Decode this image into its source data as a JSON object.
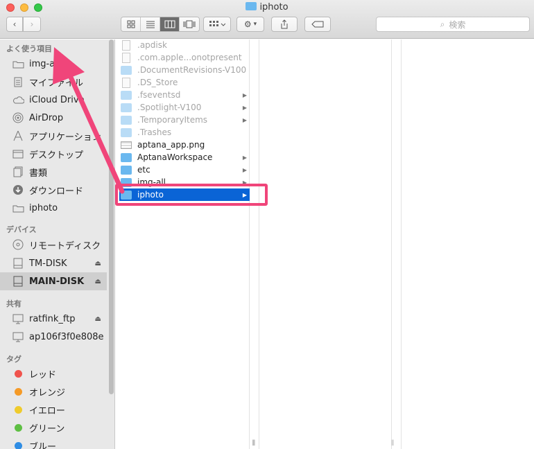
{
  "window": {
    "title": "iphoto"
  },
  "toolbar": {
    "back_icon": "chevron-left-icon",
    "forward_icon": "chevron-right-icon",
    "view_icons": [
      "icon-view",
      "list-view",
      "column-view",
      "coverflow-view"
    ],
    "active_view": "column-view",
    "search_placeholder": "検索"
  },
  "sidebar": {
    "favorites_header": "よく使う項目",
    "favorites": [
      {
        "label": "img-all",
        "icon": "folder-icon"
      },
      {
        "label": "マイファイル",
        "icon": "files-icon"
      },
      {
        "label": "iCloud Drive",
        "icon": "cloud-icon"
      },
      {
        "label": "AirDrop",
        "icon": "airdrop-icon"
      },
      {
        "label": "アプリケーション",
        "icon": "applications-icon"
      },
      {
        "label": "デスクトップ",
        "icon": "desktop-icon"
      },
      {
        "label": "書類",
        "icon": "documents-icon"
      },
      {
        "label": "ダウンロード",
        "icon": "download-icon"
      },
      {
        "label": "iphoto",
        "icon": "folder-icon"
      }
    ],
    "devices_header": "デバイス",
    "devices": [
      {
        "label": "リモートディスク",
        "icon": "disc-icon",
        "eject": false
      },
      {
        "label": "TM-DISK",
        "icon": "drive-icon",
        "eject": true
      },
      {
        "label": "MAIN-DISK",
        "icon": "drive-icon",
        "eject": true,
        "selected": true
      }
    ],
    "shared_header": "共有",
    "shared": [
      {
        "label": "ratfink_ftp",
        "icon": "display-icon",
        "eject": true
      },
      {
        "label": "ap106f3f0e808e",
        "icon": "display-icon",
        "eject": false
      }
    ],
    "tags_header": "タグ",
    "tags": [
      {
        "label": "レッド",
        "color": "#f0534c"
      },
      {
        "label": "オレンジ",
        "color": "#f59a27"
      },
      {
        "label": "イエロー",
        "color": "#efcb2c"
      },
      {
        "label": "グリーン",
        "color": "#5ebf43"
      },
      {
        "label": "ブルー",
        "color": "#2f8de4"
      }
    ]
  },
  "column1": {
    "items": [
      {
        "name": ".apdisk",
        "kind": "doc",
        "hidden": true
      },
      {
        "name": ".com.apple...onotpresent",
        "kind": "doc",
        "hidden": true
      },
      {
        "name": ".DocumentRevisions-V100",
        "kind": "folder",
        "hidden": true
      },
      {
        "name": ".DS_Store",
        "kind": "doc",
        "hidden": true
      },
      {
        "name": ".fseventsd",
        "kind": "folder",
        "hidden": true,
        "chevron": true
      },
      {
        "name": ".Spotlight-V100",
        "kind": "folder",
        "hidden": true,
        "chevron": true
      },
      {
        "name": ".TemporaryItems",
        "kind": "folder",
        "hidden": true,
        "chevron": true
      },
      {
        "name": ".Trashes",
        "kind": "folder",
        "hidden": true
      },
      {
        "name": "aptana_app.png",
        "kind": "png"
      },
      {
        "name": "AptanaWorkspace",
        "kind": "folder",
        "chevron": true
      },
      {
        "name": "etc",
        "kind": "folder",
        "chevron": true
      },
      {
        "name": "img-all",
        "kind": "folder",
        "chevron": true
      },
      {
        "name": "iphoto",
        "kind": "folder",
        "chevron": true,
        "selected": true
      }
    ]
  },
  "annotation": {
    "highlight_color": "#f0457a"
  }
}
